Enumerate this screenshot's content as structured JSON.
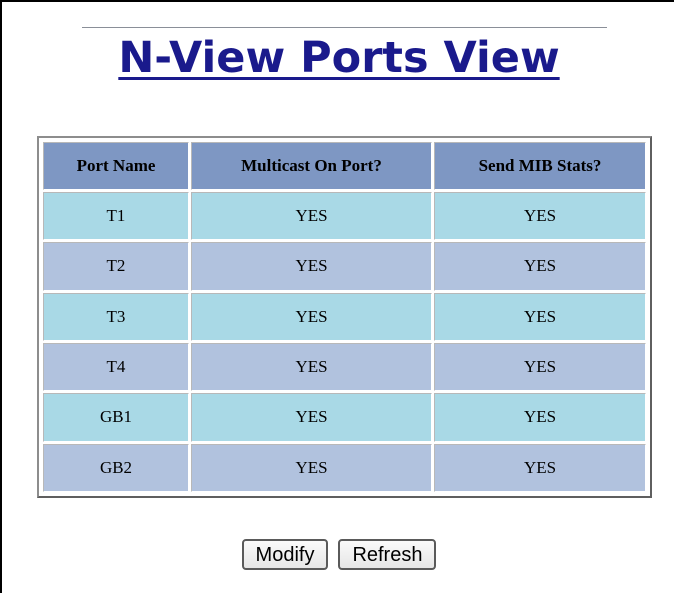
{
  "page": {
    "title": "N-View Ports View"
  },
  "table": {
    "headers": [
      "Port Name",
      "Multicast On Port?",
      "Send MIB Stats?"
    ],
    "rows": [
      {
        "port": "T1",
        "multicast": "YES",
        "mib_stats": "YES"
      },
      {
        "port": "T2",
        "multicast": "YES",
        "mib_stats": "YES"
      },
      {
        "port": "T3",
        "multicast": "YES",
        "mib_stats": "YES"
      },
      {
        "port": "T4",
        "multicast": "YES",
        "mib_stats": "YES"
      },
      {
        "port": "GB1",
        "multicast": "YES",
        "mib_stats": "YES"
      },
      {
        "port": "GB2",
        "multicast": "YES",
        "mib_stats": "YES"
      }
    ]
  },
  "buttons": {
    "modify_label": "Modify",
    "refresh_label": "Refresh"
  },
  "colors": {
    "title": "#1a1a8c",
    "header_bg": "#7e97c3",
    "row_light": "#a9d9e6",
    "row_dark": "#b1c2de"
  }
}
